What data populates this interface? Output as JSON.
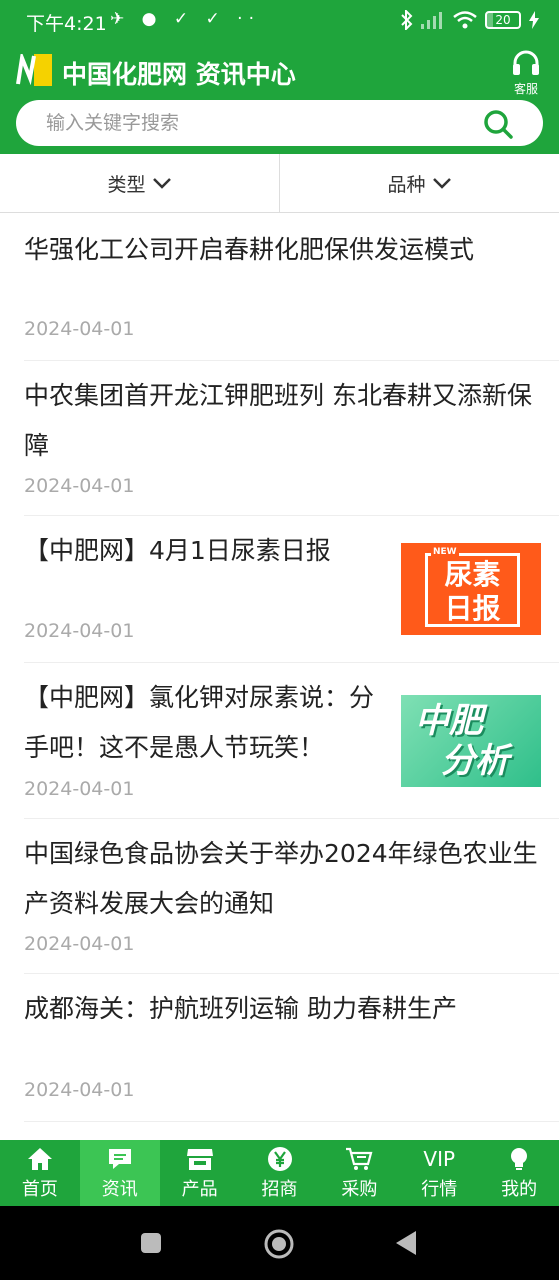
{
  "status_bar": {
    "time": "下午4:21",
    "battery": "20",
    "battery_level": 0.2
  },
  "header": {
    "title": "中国化肥网 资讯中心",
    "service_label": "客服"
  },
  "search": {
    "placeholder": "输入关键字搜索"
  },
  "filters": [
    {
      "label": "类型"
    },
    {
      "label": "品种"
    }
  ],
  "news": [
    {
      "title": "华强化工公司开启春耕化肥保供发运模式",
      "date": "2024-04-01"
    },
    {
      "title": "中农集团首开龙江钾肥班列 东北春耕又添新保障",
      "date": "2024-04-01"
    },
    {
      "title": "【中肥网】4月1日尿素日报",
      "date": "2024-04-01",
      "thumb_label_line1": "尿素",
      "thumb_label_line2": "日报",
      "thumb_badge": "NEW"
    },
    {
      "title": "【中肥网】氯化钾对尿素说：分手吧！这不是愚人节玩笑！",
      "date": "2024-04-01",
      "thumb_label_line1": "中肥",
      "thumb_label_line2": "分析"
    },
    {
      "title": "中国绿色食品协会关于举办2024年绿色农业生产资料发展大会的通知",
      "date": "2024-04-01"
    },
    {
      "title": "成都海关：护航班列运输 助力春耕生产",
      "date": "2024-04-01"
    }
  ],
  "bottom_nav": [
    {
      "label": "首页",
      "icon": "home-icon"
    },
    {
      "label": "资讯",
      "icon": "message-icon",
      "active": true
    },
    {
      "label": "产品",
      "icon": "store-icon"
    },
    {
      "label": "招商",
      "icon": "yen-icon"
    },
    {
      "label": "采购",
      "icon": "cart-icon"
    },
    {
      "label": "行情",
      "icon": "vip-icon",
      "icon_text": "VIP"
    },
    {
      "label": "我的",
      "icon": "bulb-icon"
    }
  ],
  "colors": {
    "brand_green": "#1fa53c",
    "active_tab": "#3cc554",
    "thumb_orange": "#ff5a1a",
    "thumb_teal": "#3fc997"
  }
}
